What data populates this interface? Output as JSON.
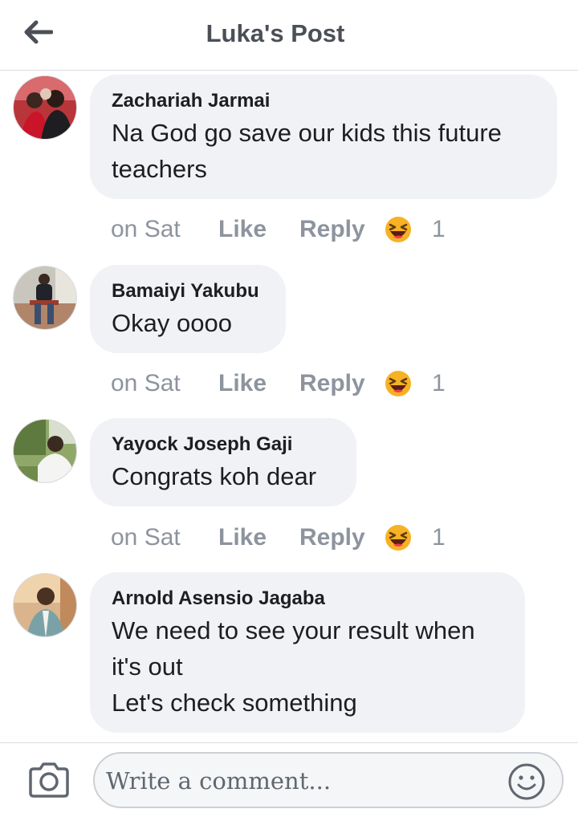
{
  "header": {
    "title": "Luka's Post",
    "back_icon": "arrow-left-icon"
  },
  "comments": [
    {
      "author": "Zachariah Jarmai",
      "lines": [
        "Na God go save our kids this future",
        "teachers"
      ],
      "time": "on Sat",
      "like_label": "Like",
      "reply_label": "Reply",
      "reaction_icon": "laughing-emoji-icon",
      "reaction_count": "1"
    },
    {
      "author": "Bamaiyi Yakubu",
      "lines": [
        "Okay oooo"
      ],
      "time": "on Sat",
      "like_label": "Like",
      "reply_label": "Reply",
      "reaction_icon": "laughing-emoji-icon",
      "reaction_count": "1"
    },
    {
      "author": "Yayock Joseph Gaji",
      "lines": [
        "Congrats koh dear"
      ],
      "time": "on Sat",
      "like_label": "Like",
      "reply_label": "Reply",
      "reaction_icon": "laughing-emoji-icon",
      "reaction_count": "1"
    },
    {
      "author": "Arnold Asensio Jagaba",
      "lines": [
        "We need to see your result when",
        "it's out",
        "Let's check something"
      ]
    }
  ],
  "composer": {
    "placeholder": "Write a comment...",
    "camera_icon": "camera-icon",
    "emoji_icon": "smiley-icon"
  },
  "colors": {
    "bubble": "#f0f2f5",
    "meta_text": "#8d949e",
    "title_text": "#4b4f56",
    "laugh_emoji": "#f7b125"
  }
}
